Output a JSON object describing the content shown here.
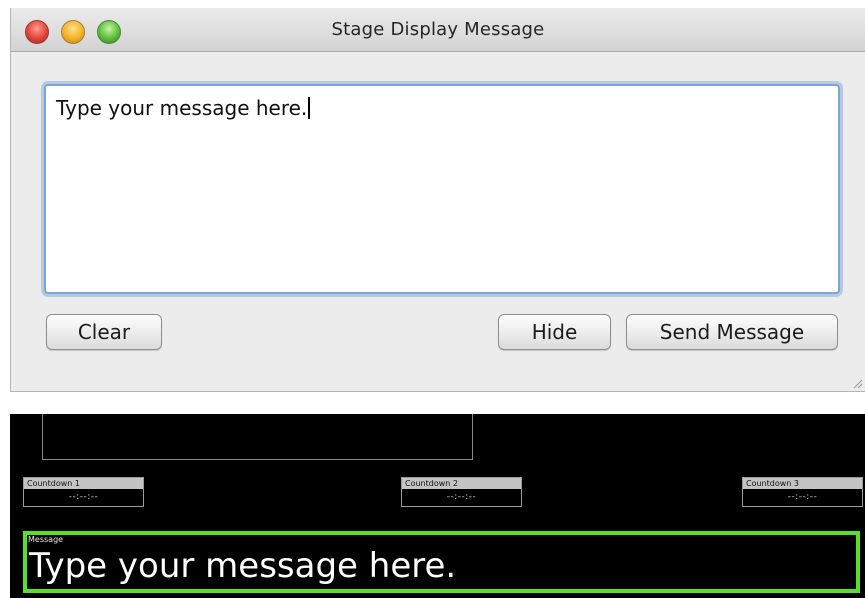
{
  "window": {
    "title": "Stage Display Message",
    "message_value": "Type your message here.",
    "buttons": {
      "clear": "Clear",
      "hide": "Hide",
      "send": "Send Message"
    }
  },
  "stage_display": {
    "countdowns": [
      {
        "label": "Countdown 1",
        "time": "--:--:--"
      },
      {
        "label": "Countdown 2",
        "time": "--:--:--"
      },
      {
        "label": "Countdown 3",
        "time": "--:--:--"
      }
    ],
    "message_label": "Message",
    "message_text": "Type your message here.",
    "message_border_color": "#55e02e"
  }
}
